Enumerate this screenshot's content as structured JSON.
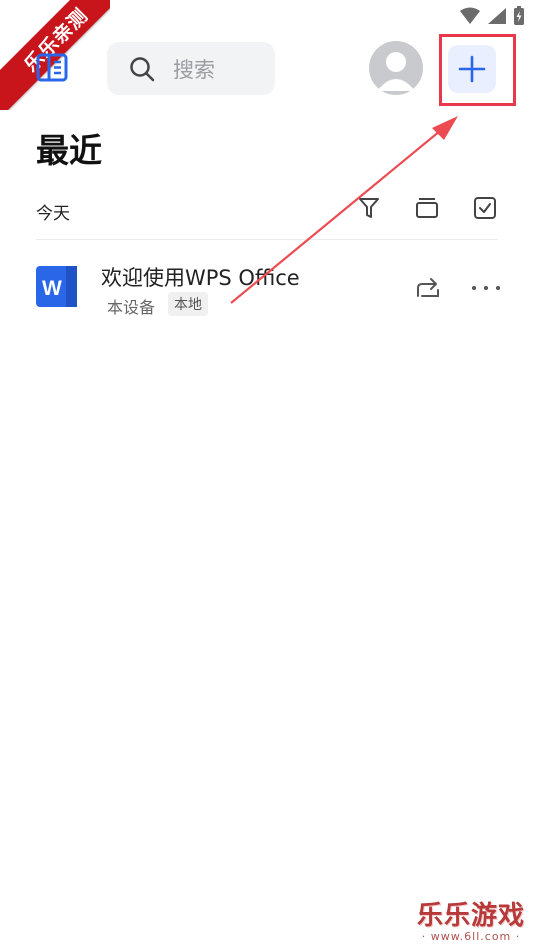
{
  "watermark": {
    "ribbon_text": "乐乐亲测",
    "site_name": "乐乐游戏",
    "site_url": "· www.6ll.com ·"
  },
  "header": {
    "search_placeholder": "搜索"
  },
  "page": {
    "title": "最近",
    "section_label": "今天"
  },
  "files": [
    {
      "name": "欢迎使用WPS Office",
      "location": "本设备",
      "tag": "本地",
      "icon": "word-doc-icon"
    }
  ],
  "colors": {
    "accent": "#2a66e8",
    "highlight": "#e8384b",
    "word_blue": "#2a66e8"
  }
}
